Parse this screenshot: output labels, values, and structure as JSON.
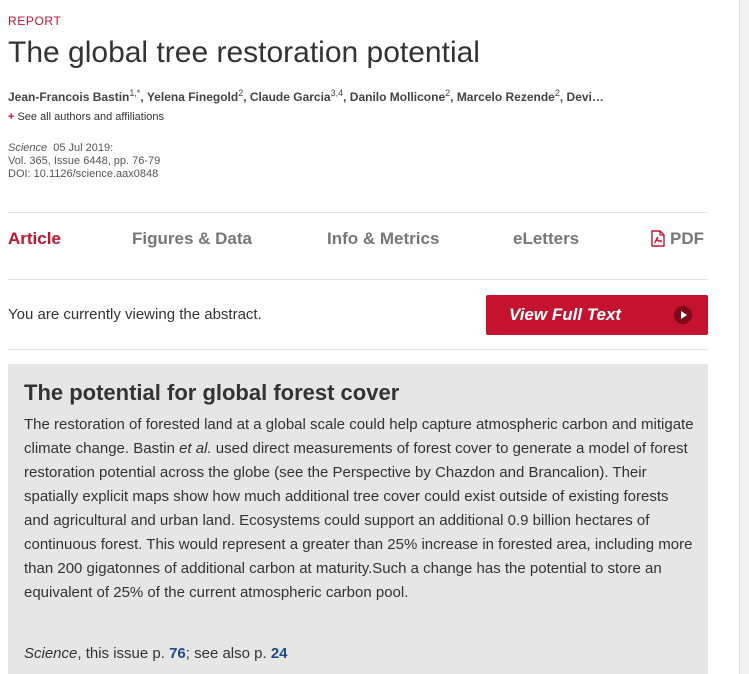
{
  "article": {
    "category": "REPORT",
    "title": "The global tree restoration potential",
    "authors": [
      {
        "name": "Jean-Francois Bastin",
        "sup": "1,*"
      },
      {
        "name": "Yelena Finegold",
        "sup": "2"
      },
      {
        "name": "Claude Garcia",
        "sup": "3,4"
      },
      {
        "name": "Danilo Mollicone",
        "sup": "2"
      },
      {
        "name": "Marcelo Rezende",
        "sup": "2"
      },
      {
        "name": "Devi…",
        "sup": ""
      }
    ],
    "see_all_label": "See all authors and affiliations",
    "journal": "Science",
    "date": "05 Jul 2019:",
    "volume_line": "Vol. 365, Issue 6448, pp. 76-79",
    "doi_line": "DOI: 10.1126/science.aax0848"
  },
  "tabs": [
    {
      "label": "Article",
      "active": true
    },
    {
      "label": "Figures & Data",
      "active": false
    },
    {
      "label": "Info & Metrics",
      "active": false
    },
    {
      "label": "eLetters",
      "active": false
    },
    {
      "label": "PDF",
      "active": false,
      "icon": "pdf-icon"
    }
  ],
  "viewing_notice": "You are currently viewing the abstract.",
  "view_full_text": {
    "label": "View Full Text",
    "icon": "play-circle-icon"
  },
  "abstract": {
    "heading": "The potential for global forest cover",
    "body_part1": "The restoration of forested land at a global scale could help capture atmospheric carbon and mitigate climate change. Bastin ",
    "body_italic": "et al.",
    "body_part2": " used direct measurements of forest cover to generate a model of forest restoration potential across the globe (see the Perspective by Chazdon and Brancalion). Their spatially explicit maps show how much additional tree cover could exist outside of existing forests and agricultural and urban land. Ecosystems could support an additional 0.9 billion hectares of continuous forest. This would represent a greater than 25% increase in forested area, including more than 200 gigatonnes of additional carbon at maturity.Such a change has the potential to store an equivalent of 25% of the current atmospheric carbon pool.",
    "citation": {
      "journal": "Science",
      "text1": ", this issue p. ",
      "page1": "76",
      "text2": "; see also p. ",
      "page2": "24"
    }
  },
  "colors": {
    "accent": "#c4122f",
    "link": "#1f4a8c",
    "abstract_bg": "#e6e6e6"
  }
}
